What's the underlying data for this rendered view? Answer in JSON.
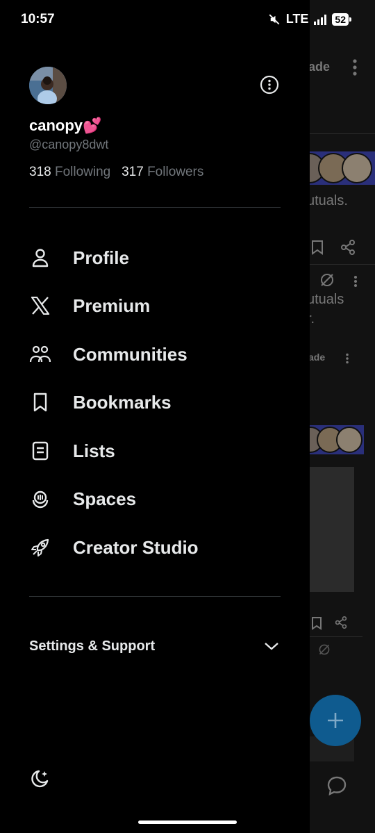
{
  "status": {
    "time": "10:57",
    "network": "LTE",
    "battery": "52"
  },
  "profile": {
    "display_name": "canopy💕",
    "handle": "@canopy8dwt",
    "following_count": "318",
    "following_label": "Following",
    "followers_count": "317",
    "followers_label": "Followers"
  },
  "nav": {
    "items": [
      {
        "label": "Profile",
        "icon": "person-icon"
      },
      {
        "label": "Premium",
        "icon": "x-logo-icon"
      },
      {
        "label": "Communities",
        "icon": "communities-icon"
      },
      {
        "label": "Bookmarks",
        "icon": "bookmark-icon"
      },
      {
        "label": "Lists",
        "icon": "list-icon"
      },
      {
        "label": "Spaces",
        "icon": "spaces-icon"
      },
      {
        "label": "Creator Studio",
        "icon": "rocket-icon"
      }
    ]
  },
  "settings": {
    "label": "Settings & Support"
  },
  "feed": {
    "snippet_1": "ade",
    "snippet_2": "utuals.",
    "snippet_3": "utuals",
    "snippet_4": "r.",
    "snippet_5": "ade"
  },
  "colors": {
    "background": "#000000",
    "text": "#e7e9ea",
    "muted": "#71767b",
    "fab": "#0f5b8f"
  }
}
